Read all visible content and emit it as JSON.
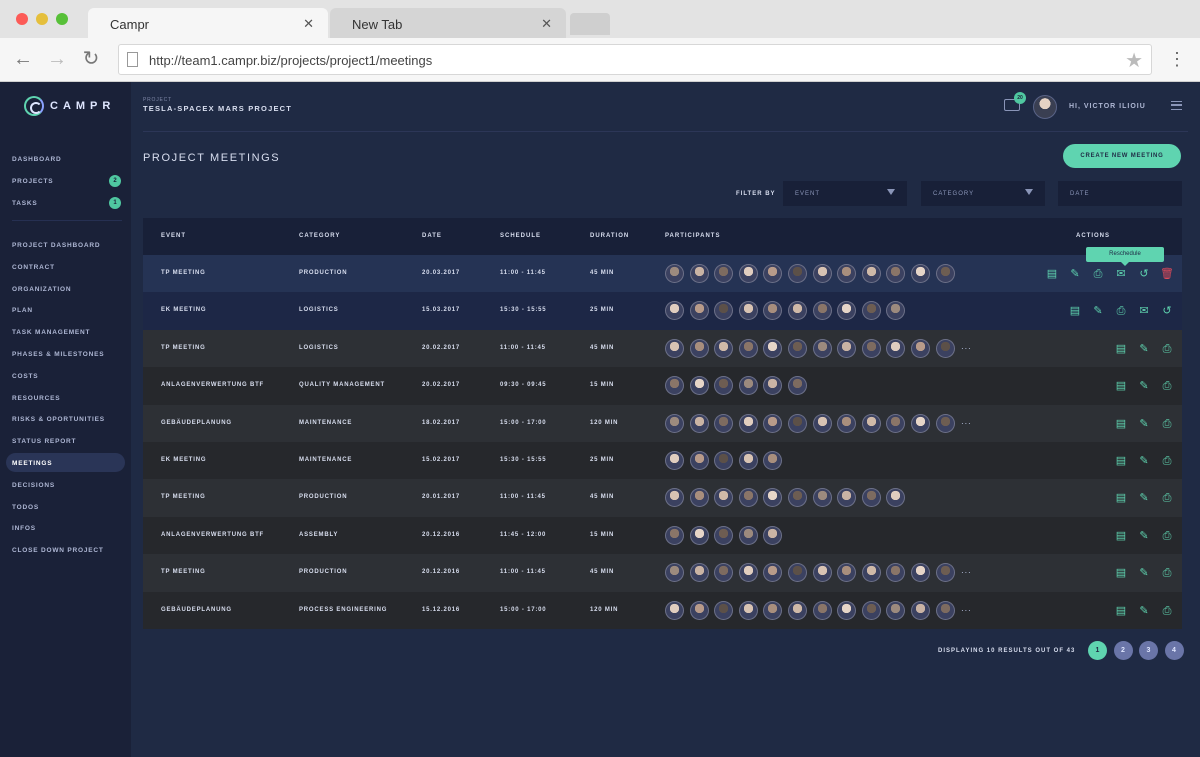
{
  "browser": {
    "tabs": [
      {
        "title": "Campr",
        "active": true
      },
      {
        "title": "New Tab",
        "active": false
      }
    ],
    "close_glyph": "✕",
    "url": "http://team1.campr.biz/projects/project1/meetings",
    "icons": {
      "back": "←",
      "forward": "→",
      "reload": "↻",
      "star": "★",
      "menu": "⋮"
    }
  },
  "app": {
    "logo_text": "CAMPR",
    "colors": {
      "accent": "#5fd4b0",
      "danger": "#e04a5a",
      "sidebar": "#1a2138",
      "content": "#1f2a44"
    },
    "header": {
      "project_label": "PROJECT",
      "project_title": "TESLA-SPACEX MARS PROJECT",
      "chat_count": "20",
      "greeting": "HI, VICTOR ILIOIU"
    },
    "sidebar": {
      "top_items": [
        {
          "label": "DASHBOARD",
          "badge": ""
        },
        {
          "label": "PROJECTS",
          "badge": "2"
        },
        {
          "label": "TASKS",
          "badge": "1"
        }
      ],
      "items": [
        "PROJECT DASHBOARD",
        "CONTRACT",
        "ORGANIZATION",
        "PLAN",
        "TASK MANAGEMENT",
        "PHASES & MILESTONES",
        "COSTS",
        "RESOURCES",
        "RISKS & OPORTUNITIES",
        "STATUS REPORT",
        "MEETINGS",
        "DECISIONS",
        "TODOS",
        "INFOS",
        "CLOSE DOWN PROJECT"
      ],
      "active_item": "MEETINGS"
    },
    "page": {
      "title": "PROJECT MEETINGS",
      "create_button": "CREATE NEW MEETING",
      "filter_label": "FILTER BY",
      "filters": {
        "event": "EVENT",
        "category": "CATEGORY",
        "date": "DATE"
      }
    },
    "table": {
      "headers": {
        "event": "EVENT",
        "category": "CATEGORY",
        "date": "DATE",
        "schedule": "SCHEDULE",
        "duration": "DURATION",
        "participants": "PARTICIPANTS",
        "actions": "ACTIONS"
      },
      "more_indicator": "...",
      "tooltip": "Reschedule",
      "rows": [
        {
          "event": "TP MEETING",
          "category": "PRODUCTION",
          "date": "20.03.2017",
          "schedule": "11:00 - 11:45",
          "duration": "45 MIN",
          "participants": 12,
          "overflow": false
        },
        {
          "event": "EK MEETING",
          "category": "LOGISTICS",
          "date": "15.03.2017",
          "schedule": "15:30 - 15:55",
          "duration": "25 MIN",
          "participants": 10,
          "overflow": false
        },
        {
          "event": "TP MEETING",
          "category": "LOGISTICS",
          "date": "20.02.2017",
          "schedule": "11:00 - 11:45",
          "duration": "45 MIN",
          "participants": 12,
          "overflow": true
        },
        {
          "event": "ANLAGENVERWERTUNG BTF",
          "category": "QUALITY MANAGEMENT",
          "date": "20.02.2017",
          "schedule": "09:30 - 09:45",
          "duration": "15 MIN",
          "participants": 6,
          "overflow": false
        },
        {
          "event": "GEBÄUDEPLANUNG",
          "category": "MAINTENANCE",
          "date": "18.02.2017",
          "schedule": "15:00 - 17:00",
          "duration": "120 MIN",
          "participants": 12,
          "overflow": true
        },
        {
          "event": "EK MEETING",
          "category": "MAINTENANCE",
          "date": "15.02.2017",
          "schedule": "15:30 - 15:55",
          "duration": "25 MIN",
          "participants": 5,
          "overflow": false
        },
        {
          "event": "TP MEETING",
          "category": "PRODUCTION",
          "date": "20.01.2017",
          "schedule": "11:00 - 11:45",
          "duration": "45 MIN",
          "participants": 10,
          "overflow": false
        },
        {
          "event": "ANLAGENVERWERTUNG BTF",
          "category": "ASSEMBLY",
          "date": "20.12.2016",
          "schedule": "11:45 - 12:00",
          "duration": "15 MIN",
          "participants": 5,
          "overflow": false
        },
        {
          "event": "TP MEETING",
          "category": "PRODUCTION",
          "date": "20.12.2016",
          "schedule": "11:00 - 11:45",
          "duration": "45 MIN",
          "participants": 12,
          "overflow": true
        },
        {
          "event": "GEBÄUDEPLANUNG",
          "category": "PROCESS ENGINEERING",
          "date": "15.12.2016",
          "schedule": "15:00 - 17:00",
          "duration": "120 MIN",
          "participants": 12,
          "overflow": true
        }
      ],
      "action_icons": {
        "full": [
          "notes-icon",
          "edit-icon",
          "print-icon",
          "email-icon",
          "reschedule-icon",
          "delete-icon"
        ],
        "no_delete": [
          "notes-icon",
          "edit-icon",
          "print-icon",
          "email-icon",
          "reschedule-icon"
        ],
        "basic": [
          "notes-icon",
          "edit-icon",
          "print-icon"
        ]
      }
    },
    "pagination": {
      "label": "DISPLAYING 10 RESULTS OUT OF 43",
      "pages": [
        "1",
        "2",
        "3",
        "4"
      ],
      "current": "1"
    }
  }
}
